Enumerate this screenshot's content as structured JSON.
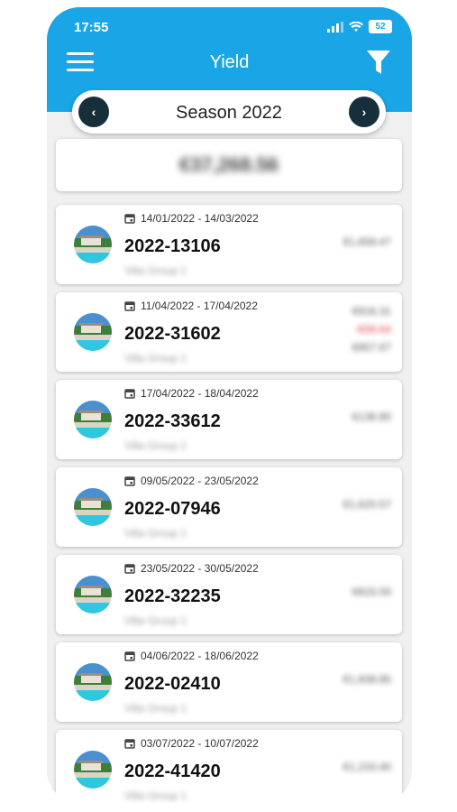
{
  "status": {
    "time": "17:55",
    "battery": "52"
  },
  "header": {
    "title": "Yield",
    "menu_icon": "menu-icon",
    "filter_icon": "filter-icon"
  },
  "season": {
    "label": "Season 2022",
    "prev": "‹",
    "next": "›"
  },
  "total": {
    "value": "€37,268.56"
  },
  "bookings": [
    {
      "dates": "14/01/2022 - 14/03/2022",
      "id": "2022-13106",
      "subtitle": "Villa Group 1",
      "amounts": [
        "€1,658.47"
      ]
    },
    {
      "dates": "11/04/2022 - 17/04/2022",
      "id": "2022-31602",
      "subtitle": "Villa Group 1",
      "amounts": [
        "€916.31",
        "-€58.64",
        "€857.67"
      ]
    },
    {
      "dates": "17/04/2022 - 18/04/2022",
      "id": "2022-33612",
      "subtitle": "Villa Group 1",
      "amounts": [
        "€136.80"
      ]
    },
    {
      "dates": "09/05/2022 - 23/05/2022",
      "id": "2022-07946",
      "subtitle": "Villa Group 1",
      "amounts": [
        "€1,620.57"
      ]
    },
    {
      "dates": "23/05/2022 - 30/05/2022",
      "id": "2022-32235",
      "subtitle": "Villa Group 1",
      "amounts": [
        "€815.00"
      ]
    },
    {
      "dates": "04/06/2022 - 18/06/2022",
      "id": "2022-02410",
      "subtitle": "Villa Group 1",
      "amounts": [
        "€1,838.85"
      ]
    },
    {
      "dates": "03/07/2022 - 10/07/2022",
      "id": "2022-41420",
      "subtitle": "Villa Group 1",
      "amounts": [
        "€1,233.40"
      ]
    }
  ],
  "colors": {
    "header": "#1aa5e6",
    "nav_button": "#172f3b",
    "background": "#f0f0f0",
    "negative": "#e03c3c"
  }
}
